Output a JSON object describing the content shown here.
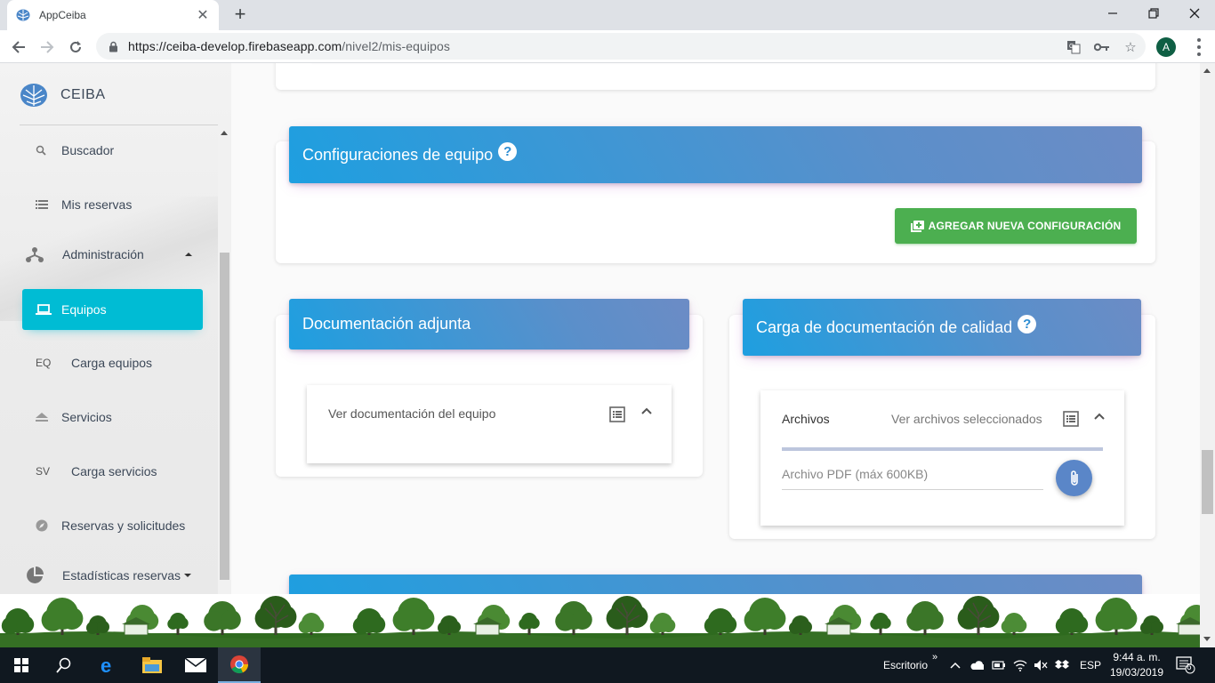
{
  "browser": {
    "tab_title": "AppCeiba",
    "url_host": "https://ceiba-develop.firebaseapp.com",
    "url_path": "/nivel2/mis-equipos",
    "profile_initial": "A"
  },
  "sidebar": {
    "brand": "CEIBA",
    "items": [
      {
        "icon": "search-icon",
        "label": "Buscador"
      },
      {
        "icon": "list-icon",
        "label": "Mis reservas"
      },
      {
        "icon": "hierarchy-icon",
        "label": "Administración"
      },
      {
        "icon": "laptop-icon",
        "label": "Equipos",
        "active": true
      },
      {
        "abbr": "EQ",
        "label": "Carga equipos"
      },
      {
        "icon": "eject-icon",
        "label": "Servicios"
      },
      {
        "abbr": "SV",
        "label": "Carga servicios"
      },
      {
        "icon": "compass-icon",
        "label": "Reservas y solicitudes"
      },
      {
        "icon": "pie-chart-icon",
        "label": "Estadísticas reservas"
      }
    ]
  },
  "main": {
    "config": {
      "title": "Configuraciones de equipo",
      "help": "?",
      "add_button": "AGREGAR NUEVA CONFIGURACIÓN"
    },
    "docs": {
      "title": "Documentación adjunta",
      "panel_text": "Ver documentación del equipo"
    },
    "quality": {
      "title": "Carga de documentación de calidad",
      "help": "?",
      "files_label": "Archivos",
      "view_selected": "Ver archivos seleccionados",
      "pdf_field": "Archivo PDF (máx 600KB)"
    }
  },
  "taskbar": {
    "desktop_label": "Escritorio",
    "lang": "ESP",
    "time": "9:44 a. m.",
    "date": "19/03/2019",
    "notifications": "6"
  }
}
